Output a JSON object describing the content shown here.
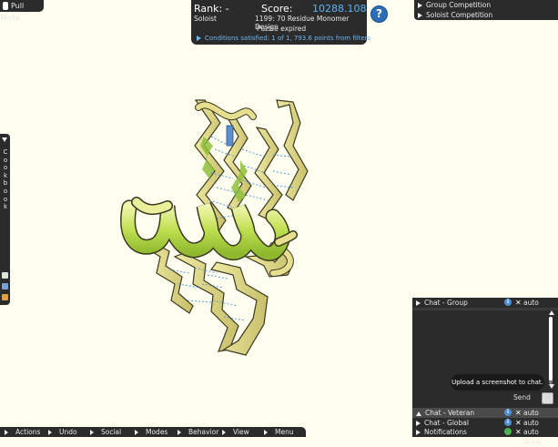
{
  "pull_mode": {
    "label": "Pull Mode"
  },
  "score_panel": {
    "rank_label": "Rank: -",
    "score_label": "Score:",
    "score_value": "10288.108",
    "mode": "Soloist",
    "puzzle": "1199: 70 Residue Monomer Design",
    "status": "Puzzle expired",
    "conditions": "Conditions satisfied: 1 of 1, 793.6 points from filters"
  },
  "help_button": {
    "label": "?"
  },
  "competitions": [
    {
      "label": "Group Competition"
    },
    {
      "label": "Soloist Competition"
    }
  ],
  "cookbook": {
    "label": "Cookbook"
  },
  "bottom_bar": [
    {
      "label": "Actions"
    },
    {
      "label": "Undo"
    },
    {
      "label": "Social"
    },
    {
      "label": "Modes"
    },
    {
      "label": "Behavior"
    },
    {
      "label": "View"
    },
    {
      "label": "Menu"
    }
  ],
  "chat": {
    "group": {
      "label": "Chat - Group",
      "auto": "auto show"
    },
    "tabs": [
      {
        "label": "Chat - Veteran",
        "auto": "auto show"
      },
      {
        "label": "Chat - Global",
        "auto": "auto show"
      },
      {
        "label": "Notifications",
        "auto": "auto show"
      }
    ],
    "tooltip": "Upload a screenshot to chat.",
    "send_label": "Send"
  },
  "colors": {
    "background": "#fffff0",
    "panel": "#2b2b2b",
    "score_value": "#5ab4f0",
    "helix": "#c6e27a",
    "strand": "#e6df8f",
    "hbond": "#5a9bd8"
  }
}
